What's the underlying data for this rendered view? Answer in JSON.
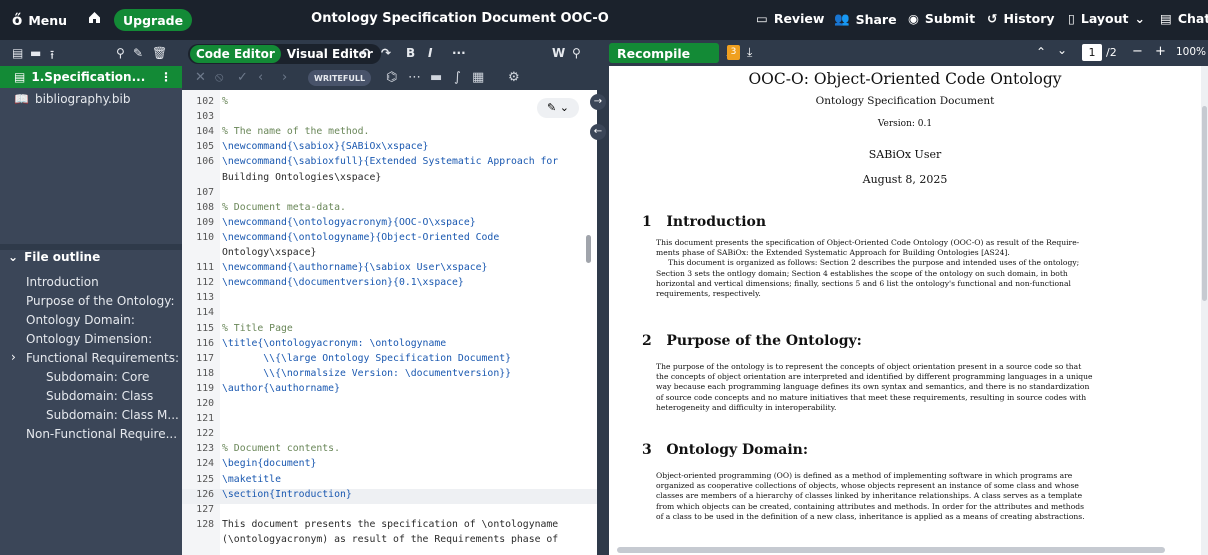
{
  "topbar": {
    "menu": "Menu",
    "upgrade": "Upgrade",
    "title": "Ontology Specification Document OOC-O",
    "review": "Review",
    "share": "Share",
    "submit": "Submit",
    "history": "History",
    "layout": "Layout",
    "chat": "Chat"
  },
  "filetree": {
    "active_file": "1.Specification...",
    "bib_file": "bibliography.bib",
    "outline_title": "File outline",
    "outline": [
      "Introduction",
      "Purpose of the Ontology:",
      "Ontology Domain:",
      "Ontology Dimension:",
      "Functional Requirements:",
      "Subdomain: Core",
      "Subdomain: Class",
      "Subdomain: Class M...",
      "Non-Functional Require..."
    ]
  },
  "editor": {
    "code_editor": "Code Editor",
    "visual_editor": "Visual Editor",
    "writefull": "WRITEFULL",
    "lines": [
      {
        "n": "102",
        "t": "%"
      },
      {
        "n": "103",
        "t": ""
      },
      {
        "n": "104",
        "t": "% The name of the method."
      },
      {
        "n": "105",
        "t": "\\newcommand{\\sabiox}{SABiOx\\xspace}"
      },
      {
        "n": "106",
        "t": "\\newcommand{\\sabioxfull}{Extended Systematic Approach for"
      },
      {
        "n": "",
        "t": "Building Ontologies\\xspace}"
      },
      {
        "n": "107",
        "t": ""
      },
      {
        "n": "108",
        "t": "% Document meta-data."
      },
      {
        "n": "109",
        "t": "\\newcommand{\\ontologyacronym}{OOC-O\\xspace}"
      },
      {
        "n": "110",
        "t": "\\newcommand{\\ontologyname}{Object-Oriented Code"
      },
      {
        "n": "",
        "t": "Ontology\\xspace}"
      },
      {
        "n": "111",
        "t": "\\newcommand{\\authorname}{\\sabiox User\\xspace}"
      },
      {
        "n": "112",
        "t": "\\newcommand{\\documentversion}{0.1\\xspace}"
      },
      {
        "n": "113",
        "t": ""
      },
      {
        "n": "114",
        "t": ""
      },
      {
        "n": "115",
        "t": "% Title Page"
      },
      {
        "n": "116",
        "t": "\\title{\\ontologyacronym: \\ontologyname"
      },
      {
        "n": "117",
        "t": "       \\\\{\\large Ontology Specification Document}"
      },
      {
        "n": "118",
        "t": "       \\\\{\\normalsize Version: \\documentversion}}"
      },
      {
        "n": "119",
        "t": "\\author{\\authorname}"
      },
      {
        "n": "120",
        "t": ""
      },
      {
        "n": "121",
        "t": ""
      },
      {
        "n": "122",
        "t": ""
      },
      {
        "n": "123",
        "t": "% Document contents."
      },
      {
        "n": "124",
        "t": "\\begin{document}"
      },
      {
        "n": "125",
        "t": "\\maketitle"
      },
      {
        "n": "126",
        "t": "\\section{Introduction}"
      },
      {
        "n": "127",
        "t": ""
      },
      {
        "n": "128",
        "t": "This document presents the specification of \\ontologyname"
      },
      {
        "n": "",
        "t": "(\\ontologyacronym) as result of the Requirements phase of"
      }
    ]
  },
  "pdf": {
    "recompile": "Recompile",
    "page": "1",
    "pages": "/2",
    "zoom": "100%",
    "title": "OOC-O: Object-Oriented Code Ontology",
    "subtitle": "Ontology Specification Document",
    "version": "Version: 0.1",
    "author": "SABiOx User",
    "date": "August 8, 2025",
    "s1": "1   Introduction",
    "p1": [
      "This document presents the specification of Object-Oriented Code Ontology (OOC-O) as result of the Require-",
      "ments phase of SABiOx: the Extended Systematic Approach for Building Ontologies [AS24].",
      "     This document is organized as follows: Section 2 describes the purpose and intended uses of the ontology;",
      "Section 3 sets the ontlogy domain; Section 4 establishes the scope of the ontology on such domain, in both",
      "horizontal and vertical dimensions; finally, sections 5 and 6 list the ontology's functional and non-functional",
      "requirements, respectively."
    ],
    "s2": "2   Purpose of the Ontology:",
    "p2": [
      "The purpose of the ontology is to represent the concepts of object orientation present in a source code so that",
      "the concepts of object orientation are interpreted and identified by different programming languages in a unique",
      "way because each programming language defines its own syntax and semantics, and there is no standardization",
      "of source code concepts and no mature initiatives that meet these requirements, resulting in source codes with",
      "heterogeneity and difficulty in interoperability."
    ],
    "s3": "3   Ontology Domain:",
    "p3": [
      "Object-oriented programming (OO) is defined as a method of implementing software in which programs are",
      "organized as cooperative collections of objects, whose objects represent an instance of some class and whose",
      "classes are members of a hierarchy of classes linked by inheritance relationships. A class serves as a template",
      "from which objects can be created, containing attributes and methods. In order for the attributes and methods",
      "of a class to be used in the definition of a new class, inheritance is applied as a means of creating abstractions."
    ]
  }
}
